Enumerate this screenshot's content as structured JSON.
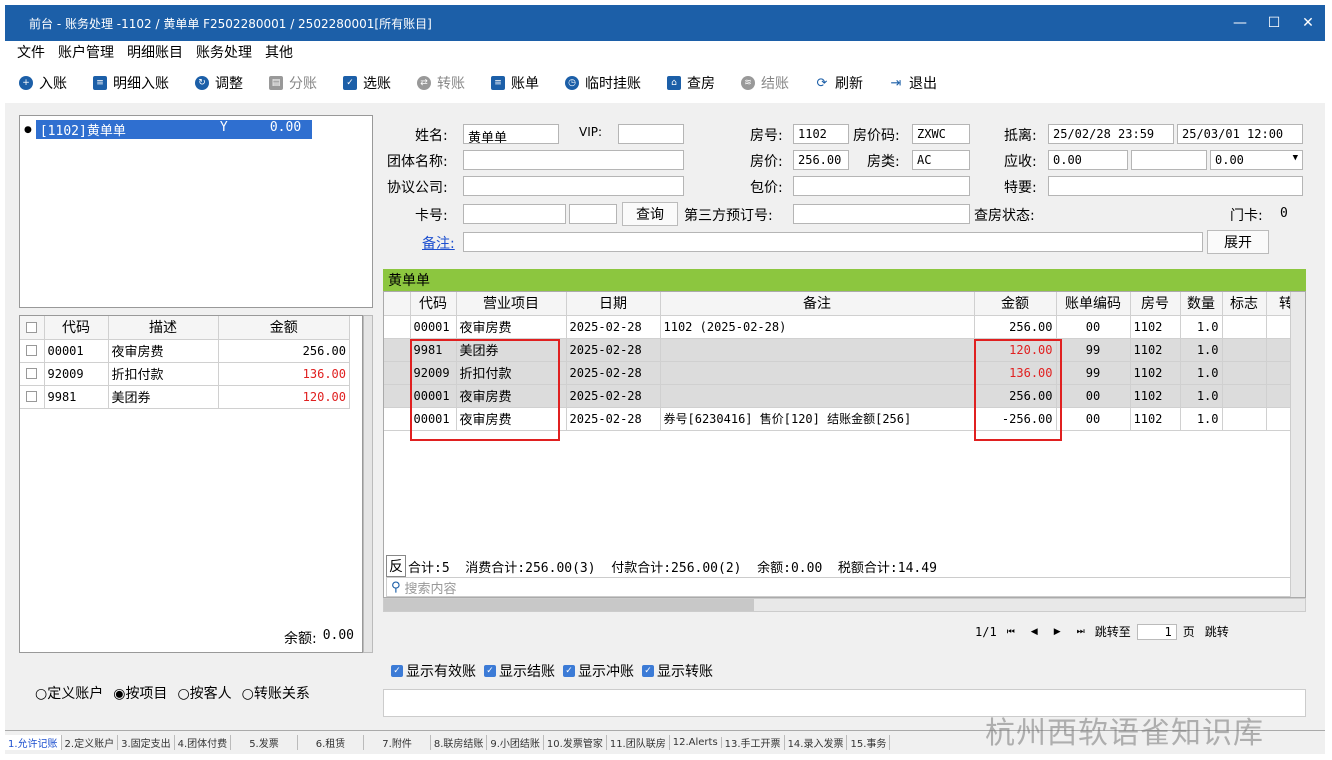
{
  "window": {
    "title": "前台 - 账务处理 -1102 / 黄单单 F2502280001 / 2502280001[所有账目]"
  },
  "menu": [
    "文件",
    "账户管理",
    "明细账目",
    "账务处理",
    "其他"
  ],
  "toolbar": [
    {
      "label": "入账",
      "icon": "plus-circle-icon",
      "disabled": false
    },
    {
      "label": "明细入账",
      "icon": "list-icon",
      "disabled": false
    },
    {
      "label": "调整",
      "icon": "adjust-icon",
      "disabled": false
    },
    {
      "label": "分账",
      "icon": "split-icon",
      "disabled": true
    },
    {
      "label": "选账",
      "icon": "select-icon",
      "disabled": false
    },
    {
      "label": "转账",
      "icon": "transfer-icon",
      "disabled": true
    },
    {
      "label": "账单",
      "icon": "bill-icon",
      "disabled": false
    },
    {
      "label": "临时挂账",
      "icon": "clock-icon",
      "disabled": false
    },
    {
      "label": "查房",
      "icon": "house-icon",
      "disabled": false
    },
    {
      "label": "结账",
      "icon": "coins-icon",
      "disabled": true
    },
    {
      "label": "刷新",
      "icon": "refresh-icon",
      "disabled": false
    },
    {
      "label": "退出",
      "icon": "exit-icon",
      "disabled": false
    }
  ],
  "account_tree": {
    "item": "[1102]黄单单",
    "flag": "Y",
    "amount": "0.00"
  },
  "left_grid": {
    "headers": [
      "代码",
      "描述",
      "金额"
    ],
    "rows": [
      {
        "code": "00001",
        "desc": "夜审房费",
        "amount": "256.00",
        "red": false
      },
      {
        "code": "92009",
        "desc": "折扣付款",
        "amount": "136.00",
        "red": true
      },
      {
        "code": "9981",
        "desc": "美团券",
        "amount": "120.00",
        "red": true
      }
    ],
    "balance_label": "余额:",
    "balance": "0.00"
  },
  "radios": [
    {
      "label": "定义账户",
      "checked": false
    },
    {
      "label": "按项目",
      "checked": true
    },
    {
      "label": "按客人",
      "checked": false
    },
    {
      "label": "转账关系",
      "checked": false
    }
  ],
  "guest": {
    "name_label": "姓名:",
    "name": "黄单单",
    "vip_label": "VIP:",
    "vip": "",
    "room_label": "房号:",
    "room": "1102",
    "rate_code_label": "房价码:",
    "rate_code": "ZXWC",
    "depart_label": "抵离:",
    "arrive": "25/02/28 23:59",
    "depart": "25/03/01 12:00",
    "group_label": "团体名称:",
    "rate_label": "房价:",
    "rate": "256.00",
    "room_type_label": "房类:",
    "room_type": "AC",
    "receivable_label": "应收:",
    "receivable": "0.00",
    "receivable2": "0.00",
    "company_label": "协议公司:",
    "package_label": "包价:",
    "special_label": "特要:",
    "card_label": "卡号:",
    "query_button": "查询",
    "third_party_label": "第三方预订号:",
    "check_status_label": "查房状态:",
    "door_card_label": "门卡:",
    "door_card": "0",
    "remark_label": "备注:",
    "expand_button": "展开"
  },
  "bill": {
    "title": "黄单单",
    "headers": [
      "代码",
      "营业项目",
      "日期",
      "备注",
      "金额",
      "账单编码",
      "房号",
      "数量",
      "标志",
      "转"
    ],
    "rows": [
      {
        "code": "00001",
        "item": "夜审房费",
        "date": "2025-02-28",
        "note": "1102 (2025-02-28)",
        "amount": "256.00",
        "bill_no": "00",
        "room": "1102",
        "qty": "1.0",
        "red": false,
        "gray": false
      },
      {
        "code": "9981",
        "item": "美团券",
        "date": "2025-02-28",
        "note": "",
        "amount": "120.00",
        "bill_no": "99",
        "room": "1102",
        "qty": "1.0",
        "red": true,
        "gray": true
      },
      {
        "code": "92009",
        "item": "折扣付款",
        "date": "2025-02-28",
        "note": "",
        "amount": "136.00",
        "bill_no": "99",
        "room": "1102",
        "qty": "1.0",
        "red": true,
        "gray": true
      },
      {
        "code": "00001",
        "item": "夜审房费",
        "date": "2025-02-28",
        "note": "",
        "amount": "256.00",
        "bill_no": "00",
        "room": "1102",
        "qty": "1.0",
        "red": false,
        "gray": true
      },
      {
        "code": "00001",
        "item": "夜审房费",
        "date": "2025-02-28",
        "note": "券号[6230416] 售价[120] 结账金额[256]",
        "amount": "-256.00",
        "bill_no": "00",
        "room": "1102",
        "qty": "1.0",
        "red": false,
        "gray": false
      }
    ],
    "reverse_label": "反",
    "summary": "合计:5  消费合计:256.00(3)  付款合计:256.00(2)  余额:0.00  税额合计:14.49",
    "search_placeholder": "搜索内容",
    "page": "1/1",
    "jump_label": "跳转至",
    "jump_value": "1",
    "page_unit": "页",
    "jump_button": "跳转"
  },
  "checkboxes": [
    "显示有效账",
    "显示结账",
    "显示冲账",
    "显示转账"
  ],
  "bottom_tabs": [
    "1.允许记账",
    "2.定义账户",
    "3.固定支出",
    "4.团体付费",
    "5.发票",
    "6.租赁",
    "7.附件",
    "8.联房结账",
    "9.小团结账",
    "10.发票管家",
    "11.团队联房",
    "12.Alerts",
    "13.手工开票",
    "14.录入发票",
    "15.事务"
  ],
  "watermark": "杭州西软语雀知识库"
}
